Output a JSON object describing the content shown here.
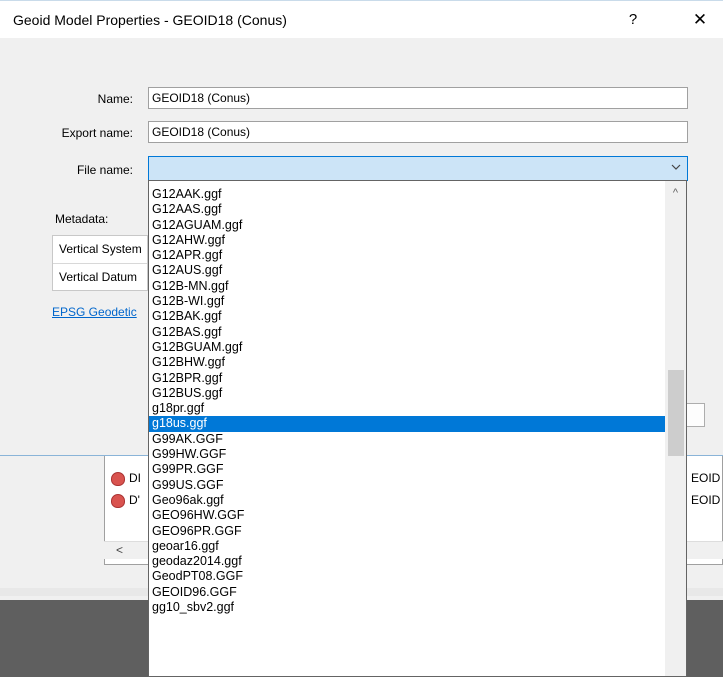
{
  "dialog": {
    "title": "Geoid Model Properties - GEOID18 (Conus)",
    "help_label": "?",
    "close_label": "✕"
  },
  "form": {
    "name_label": "Name:",
    "name_value": "GEOID18 (Conus)",
    "export_label": "Export name:",
    "export_value": "GEOID18 (Conus)",
    "file_label": "File name:",
    "file_value": "",
    "metadata_label": "Metadata:",
    "meta_rows": [
      "Vertical System",
      "Vertical Datum"
    ],
    "link_text": "EPSG Geodetic"
  },
  "dropdown": {
    "items": [
      "G12AAK.ggf",
      "G12AAS.ggf",
      "G12AGUAM.ggf",
      "G12AHW.ggf",
      "G12APR.ggf",
      "G12AUS.ggf",
      "G12B-MN.ggf",
      "G12B-WI.ggf",
      "G12BAK.ggf",
      "G12BAS.ggf",
      "G12BGUAM.ggf",
      "G12BHW.ggf",
      "G12BPR.ggf",
      "G12BUS.ggf",
      "g18pr.ggf",
      "g18us.ggf",
      "G99AK.GGF",
      "G99HW.GGF",
      "G99PR.GGF",
      "G99US.GGF",
      "Geo96ak.ggf",
      "GEO96HW.GGF",
      "GEO96PR.GGF",
      "geoar16.ggf",
      "geodaz2014.ggf",
      "GeodPT08.GGF",
      "GEOID96.GGF",
      "gg10_sbv2.ggf"
    ],
    "selected": "g18us.ggf",
    "scroll_up": "^"
  },
  "background": {
    "row1_prefix": "DI",
    "row2_prefix": "D'",
    "row1_suffix": "EOID",
    "row2_suffix": "EOID",
    "scroll_left": "<"
  }
}
